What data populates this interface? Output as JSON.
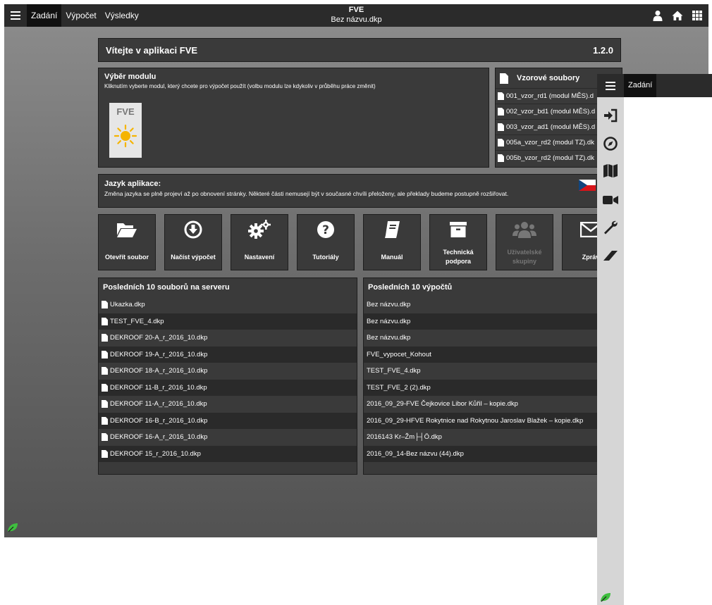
{
  "topbar": {
    "tabs": [
      "Zadání",
      "Výpočet",
      "Výsledky"
    ],
    "title": "FVE",
    "filename": "Bez názvu.dkp",
    "icons": [
      "user-icon",
      "home-icon",
      "grid-icon"
    ]
  },
  "welcome": {
    "title": "Vítejte v aplikaci FVE",
    "version": "1.2.0"
  },
  "module_select": {
    "heading": "Výběr modulu",
    "subtitle": "Kliknutím vyberte modul, který chcete pro výpočet použít (volbu modulu lze kdykoliv v průběhu práce změnit)",
    "module_label": "FVE"
  },
  "samples": {
    "heading": "Vzorové soubory",
    "items": [
      "001_vzor_rd1 (modul MĚS).d",
      "002_vzor_bd1 (modul MĚS).d",
      "003_vzor_ad1 (modul MĚS).d",
      "005a_vzor_rd2 (modul TZ).dk",
      "005b_vzor_rd2 (modul TZ).dk"
    ]
  },
  "language": {
    "heading": "Jazyk aplikace:",
    "subtitle": "Změna jazyka se plně projeví až po obnovení stránky. Některé části nemusejí být v současné chvíli přeloženy, ale překlady budeme postupně rozšiřovat."
  },
  "actions": [
    {
      "label": "Otevřít soubor",
      "icon": "folder-open-icon",
      "enabled": true
    },
    {
      "label": "Načíst výpočet",
      "icon": "download-circle-icon",
      "enabled": true
    },
    {
      "label": "Nastavení",
      "icon": "gears-icon",
      "enabled": true
    },
    {
      "label": "Tutoriály",
      "icon": "question-circle-icon",
      "enabled": true
    },
    {
      "label": "Manuál",
      "icon": "book-icon",
      "enabled": true
    },
    {
      "label": "Technická podpora",
      "icon": "archive-icon",
      "enabled": true
    },
    {
      "label": "Uživatelské skupiny",
      "icon": "users-icon",
      "enabled": false
    },
    {
      "label": "Zpráv",
      "icon": "envelope-icon",
      "enabled": true
    }
  ],
  "recent_files": {
    "heading": "Posledních 10 souborů na serveru",
    "items": [
      "Ukazka.dkp",
      "TEST_FVE_4.dkp",
      "DEKROOF 20-A_r_2016_10.dkp",
      "DEKROOF 19-A_r_2016_10.dkp",
      "DEKROOF 18-A_r_2016_10.dkp",
      "DEKROOF 11-B_r_2016_10.dkp",
      "DEKROOF 11-A_r_2016_10.dkp",
      "DEKROOF 16-B_r_2016_10.dkp",
      "DEKROOF 16-A_r_2016_10.dkp",
      "DEKROOF 15_r_2016_10.dkp"
    ]
  },
  "recent_calcs": {
    "heading": "Posledních 10 výpočtů",
    "items": [
      "Bez názvu.dkp",
      "Bez názvu.dkp",
      "Bez názvu.dkp",
      "FVE_vypocet_Kohout",
      "TEST_FVE_4.dkp",
      "TEST_FVE_2 (2).dkp",
      "2016_09_29-FVE Čejkovice Libor Kůřil – kopie.dkp",
      "2016_09_29-HFVE Rokytnice nad Rokytnou Jaroslav Blažek – kopie.dkp",
      "2016143 Kr–Žm├┤Ö.dkp",
      "2016_09_14-Bez názvu (44).dkp"
    ]
  },
  "overlay": {
    "tab": "Zadání",
    "rail_icons": [
      "sign-in-icon",
      "compass-icon",
      "map-icon",
      "video-icon",
      "wrench-icon",
      "eraser-icon"
    ]
  },
  "colors": {
    "accent_green": "#3fbf3f",
    "flag_blue": "#11457e",
    "flag_red": "#d7141a",
    "sun": "#f5b400"
  }
}
